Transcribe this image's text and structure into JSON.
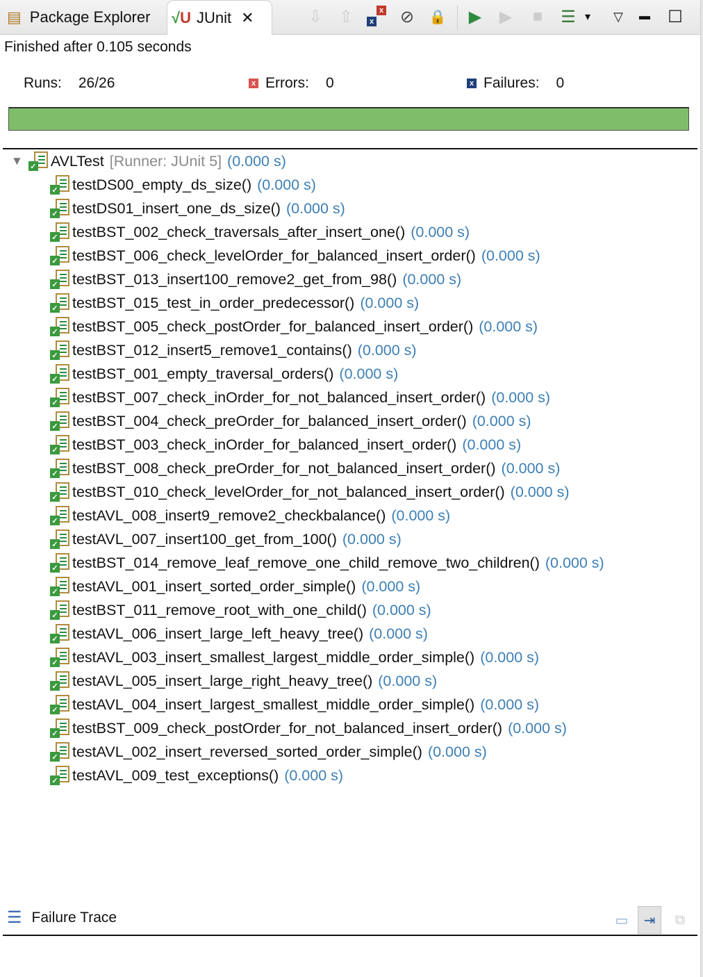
{
  "tabs": [
    {
      "label": "Package Explorer"
    },
    {
      "label": "JUnit"
    }
  ],
  "toolbar": {
    "next_failure": "⇩",
    "prev_failure": "⇧",
    "show_failures_only": "x",
    "scroll_lock": "⊘",
    "history": "🔒",
    "rerun": "▶",
    "rerun_failed": "▶",
    "stop": "■",
    "layout_menu": "☰",
    "view_menu": "▽",
    "minimize": "▬",
    "maximize": "☐",
    "dropdown": "▾"
  },
  "status": "Finished after 0.105 seconds",
  "counters": {
    "runs_label": "Runs:",
    "runs_value": "26/26",
    "errors_label": "Errors:",
    "errors_value": "0",
    "failures_label": "Failures:",
    "failures_value": "0"
  },
  "progress": {
    "fraction": 1.0,
    "color": "#7fbd6a"
  },
  "root": {
    "name": "AVLTest",
    "runner": "[Runner: JUnit 5]",
    "time": "(0.000 s)"
  },
  "tests": [
    {
      "name": "testDS00_empty_ds_size()",
      "time": "(0.000 s)"
    },
    {
      "name": "testDS01_insert_one_ds_size()",
      "time": "(0.000 s)"
    },
    {
      "name": "testBST_002_check_traversals_after_insert_one()",
      "time": "(0.000 s)"
    },
    {
      "name": "testBST_006_check_levelOrder_for_balanced_insert_order()",
      "time": "(0.000 s)"
    },
    {
      "name": "testBST_013_insert100_remove2_get_from_98()",
      "time": "(0.000 s)"
    },
    {
      "name": "testBST_015_test_in_order_predecessor()",
      "time": "(0.000 s)"
    },
    {
      "name": "testBST_005_check_postOrder_for_balanced_insert_order()",
      "time": "(0.000 s)"
    },
    {
      "name": "testBST_012_insert5_remove1_contains()",
      "time": "(0.000 s)"
    },
    {
      "name": "testBST_001_empty_traversal_orders()",
      "time": "(0.000 s)"
    },
    {
      "name": "testBST_007_check_inOrder_for_not_balanced_insert_order()",
      "time": "(0.000 s)"
    },
    {
      "name": "testBST_004_check_preOrder_for_balanced_insert_order()",
      "time": "(0.000 s)"
    },
    {
      "name": "testBST_003_check_inOrder_for_balanced_insert_order()",
      "time": "(0.000 s)"
    },
    {
      "name": "testBST_008_check_preOrder_for_not_balanced_insert_order()",
      "time": "(0.000 s)"
    },
    {
      "name": "testBST_010_check_levelOrder_for_not_balanced_insert_order()",
      "time": "(0.000 s)"
    },
    {
      "name": "testAVL_008_insert9_remove2_checkbalance()",
      "time": "(0.000 s)"
    },
    {
      "name": "testAVL_007_insert100_get_from_100()",
      "time": "(0.000 s)"
    },
    {
      "name": "testBST_014_remove_leaf_remove_one_child_remove_two_children()",
      "time": "(0.000 s)"
    },
    {
      "name": "testAVL_001_insert_sorted_order_simple()",
      "time": "(0.000 s)"
    },
    {
      "name": "testBST_011_remove_root_with_one_child()",
      "time": "(0.000 s)"
    },
    {
      "name": "testAVL_006_insert_large_left_heavy_tree()",
      "time": "(0.000 s)"
    },
    {
      "name": "testAVL_003_insert_smallest_largest_middle_order_simple()",
      "time": "(0.000 s)"
    },
    {
      "name": "testAVL_005_insert_large_right_heavy_tree()",
      "time": "(0.000 s)"
    },
    {
      "name": "testAVL_004_insert_largest_smallest_middle_order_simple()",
      "time": "(0.000 s)"
    },
    {
      "name": "testBST_009_check_postOrder_for_not_balanced_insert_order()",
      "time": "(0.000 s)"
    },
    {
      "name": "testAVL_002_insert_reversed_sorted_order_simple()",
      "time": "(0.000 s)"
    },
    {
      "name": "testAVL_009_test_exceptions()",
      "time": "(0.000 s)"
    }
  ],
  "failure_trace": {
    "label": "Failure Trace"
  }
}
